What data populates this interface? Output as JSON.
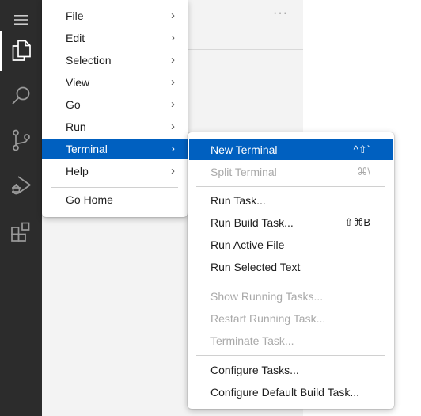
{
  "colors": {
    "activity_bar": "#2c2c2c",
    "sidebar": "#f3f3f3",
    "selection": "#0060c0",
    "disabled_text": "#a9a9a9"
  },
  "activity_bar": {
    "icons": [
      "menu-icon",
      "explorer-icon",
      "search-icon",
      "source-control-icon",
      "run-debug-icon",
      "extensions-icon"
    ]
  },
  "sidebar": {
    "more_actions": "···"
  },
  "main_menu": {
    "items": [
      {
        "label": "File",
        "submenu": true
      },
      {
        "label": "Edit",
        "submenu": true
      },
      {
        "label": "Selection",
        "submenu": true
      },
      {
        "label": "View",
        "submenu": true
      },
      {
        "label": "Go",
        "submenu": true
      },
      {
        "label": "Run",
        "submenu": true
      },
      {
        "label": "Terminal",
        "submenu": true,
        "selected": true
      },
      {
        "label": "Help",
        "submenu": true
      }
    ],
    "go_home": "Go Home",
    "chevron": "›"
  },
  "terminal_menu": {
    "new_terminal": {
      "label": "New Terminal",
      "shortcut": "^⇧`"
    },
    "split_terminal": {
      "label": "Split Terminal",
      "shortcut": "⌘\\",
      "disabled": true
    },
    "run_task": {
      "label": "Run Task..."
    },
    "run_build_task": {
      "label": "Run Build Task...",
      "shortcut": "⇧⌘B"
    },
    "run_active_file": {
      "label": "Run Active File"
    },
    "run_selected_text": {
      "label": "Run Selected Text"
    },
    "show_running_tasks": {
      "label": "Show Running Tasks...",
      "disabled": true
    },
    "restart_running_task": {
      "label": "Restart Running Task...",
      "disabled": true
    },
    "terminate_task": {
      "label": "Terminate Task...",
      "disabled": true
    },
    "configure_tasks": {
      "label": "Configure Tasks..."
    },
    "configure_default_build_task": {
      "label": "Configure Default Build Task..."
    }
  }
}
